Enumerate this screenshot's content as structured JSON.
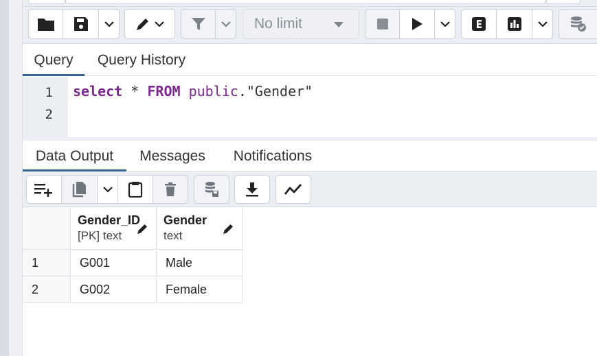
{
  "toolbar": {
    "limit_select": {
      "value": "No limit"
    },
    "buttons": [
      {
        "name": "open-file-button",
        "icon": "folder-icon"
      },
      {
        "name": "save-file-button",
        "icon": "save-icon"
      },
      {
        "name": "save-options-button",
        "icon": "chevron-down-icon"
      },
      {
        "name": "edit-button",
        "icon": "pencil-icon"
      },
      {
        "name": "filter-button",
        "icon": "filter-icon"
      },
      {
        "name": "filter-options-button",
        "icon": "chevron-down-icon"
      },
      {
        "name": "stop-button",
        "icon": "stop-icon"
      },
      {
        "name": "execute-button",
        "icon": "play-icon"
      },
      {
        "name": "execute-options-button",
        "icon": "chevron-down-icon"
      },
      {
        "name": "explain-button",
        "icon": "explain-icon",
        "label": "E"
      },
      {
        "name": "explain-analyze-button",
        "icon": "bar-chart-icon"
      },
      {
        "name": "explain-options-button",
        "icon": "chevron-down-icon"
      },
      {
        "name": "commit-button",
        "icon": "database-check-icon"
      }
    ]
  },
  "editor_tabs": [
    {
      "label": "Query",
      "active": true
    },
    {
      "label": "Query History",
      "active": false
    }
  ],
  "editor": {
    "line_numbers": [
      "1",
      "2"
    ],
    "tokens": {
      "kw_select": "select",
      "op_star": " * ",
      "kw_from": "FROM",
      "sp": " ",
      "schema": "public",
      "dot": ".",
      "table": "\"Gender\""
    }
  },
  "output_tabs": [
    {
      "label": "Data Output",
      "active": true
    },
    {
      "label": "Messages",
      "active": false
    },
    {
      "label": "Notifications",
      "active": false
    }
  ],
  "output_toolbar": [
    {
      "name": "add-row-button",
      "icon": "add-row-icon"
    },
    {
      "name": "copy-button",
      "icon": "copy-icon"
    },
    {
      "name": "copy-options-button",
      "icon": "chevron-down-icon"
    },
    {
      "name": "paste-button",
      "icon": "clipboard-icon"
    },
    {
      "name": "delete-button",
      "icon": "trash-icon"
    },
    {
      "name": "save-data-button",
      "icon": "database-save-icon"
    },
    {
      "name": "download-button",
      "icon": "download-icon"
    },
    {
      "name": "graph-button",
      "icon": "line-chart-icon"
    }
  ],
  "grid": {
    "columns": [
      {
        "name": "Gender_ID",
        "type": "[PK] text"
      },
      {
        "name": "Gender",
        "type": "text"
      }
    ],
    "rows": [
      {
        "num": "1",
        "cells": [
          "G001",
          "Male"
        ]
      },
      {
        "num": "2",
        "cells": [
          "G002",
          "Female"
        ]
      }
    ]
  },
  "colors": {
    "accent": "#326690",
    "keyword": "#7a2a8a",
    "toolbar_bg": "#ebeef2"
  }
}
